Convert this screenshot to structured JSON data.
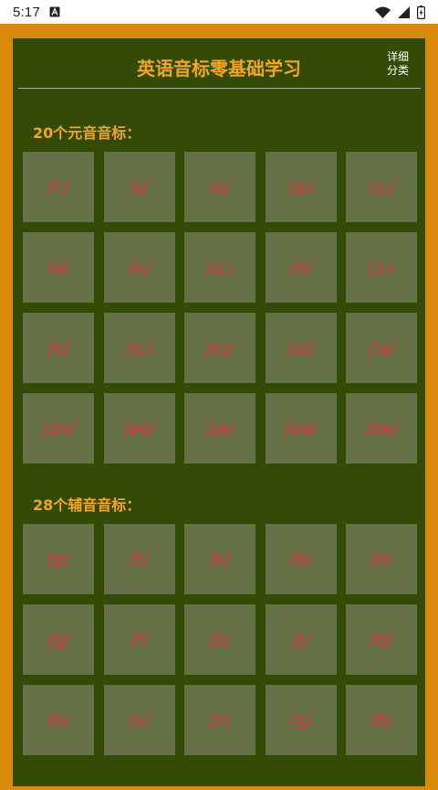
{
  "status_bar": {
    "time": "5:17",
    "icons": [
      "font-a-icon",
      "wifi-icon",
      "signal-icon",
      "battery-charging-icon"
    ]
  },
  "header": {
    "title": "英语音标零基础学习",
    "detail_button": [
      "详细",
      "分类"
    ]
  },
  "vowels": {
    "title": "20个元音音标：",
    "items": [
      "/iː/",
      "/ɪ/",
      "/e/",
      "/æ/",
      "/ɜː/",
      "/ə/",
      "/ʌ/",
      "/uː/",
      "/ʊ/",
      "/ɔː/",
      "/ɒ/",
      "/ɑː/",
      "/eɪ/",
      "/aɪ/",
      "/ɔɪ/",
      "/aʊ/",
      "/əʊ/",
      "/ɪə/",
      "/eə/",
      "/ʊə/"
    ]
  },
  "consonants": {
    "title": "28个辅音音标：",
    "items": [
      "/p/",
      "/t/",
      "/k/",
      "/b/",
      "/d/",
      "/g/",
      "/f/",
      "/s/",
      "/ʃ/",
      "/θ/",
      "/h/",
      "/v/",
      "/z/",
      "/ʒ/",
      "/ð/"
    ]
  },
  "colors": {
    "frame": "#d98a0a",
    "board": "#344a07",
    "accent": "#f0a623",
    "tile": "#667147",
    "symbol": "#e2353a"
  }
}
